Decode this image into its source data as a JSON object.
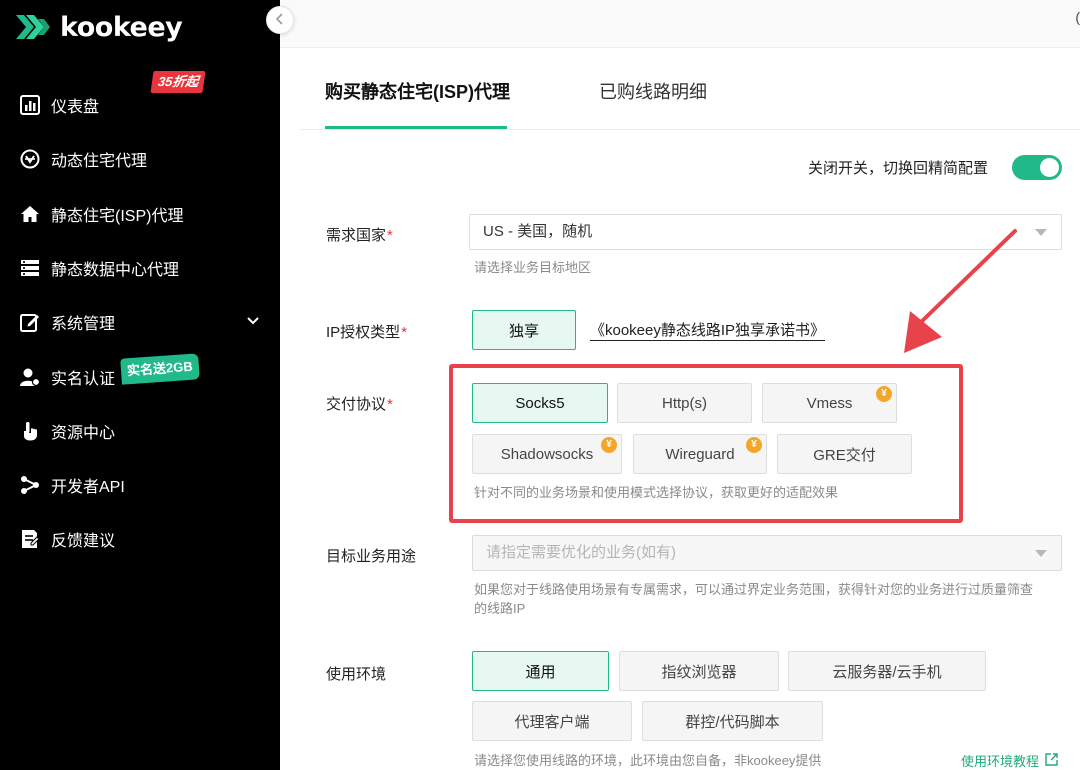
{
  "sidebar": {
    "logo_text": "kookeey",
    "items": [
      {
        "label": "仪表盘",
        "icon": "dashboard-chart-icon"
      },
      {
        "label": "动态住宅代理",
        "icon": "dynamic-proxy-icon"
      },
      {
        "label": "静态住宅(ISP)代理",
        "icon": "home-icon"
      },
      {
        "label": "静态数据中心代理",
        "icon": "server-icon"
      },
      {
        "label": "系统管理",
        "icon": "edit-icon"
      },
      {
        "label": "实名认证",
        "icon": "user-verify-icon"
      },
      {
        "label": "资源中心",
        "icon": "hand-pointer-icon"
      },
      {
        "label": "开发者API",
        "icon": "api-nodes-icon"
      },
      {
        "label": "反馈建议",
        "icon": "feedback-icon"
      }
    ],
    "promo_badge": "35折起",
    "verify_badge": "实名送2GB"
  },
  "topbar": {
    "edge_text": "("
  },
  "tabs": [
    {
      "label": "购买静态住宅(ISP)代理",
      "active": true
    },
    {
      "label": "已购线路明细",
      "active": false
    }
  ],
  "toggle": {
    "label": "关闭开关，切换回精简配置",
    "on": true
  },
  "form": {
    "country": {
      "label": "需求国家",
      "value": "US - 美国，随机",
      "hint": "请选择业务目标地区"
    },
    "ip_auth": {
      "label": "IP授权类型",
      "option": "独享",
      "agreement": "《kookeey静态线路IP独享承诺书》"
    },
    "protocol": {
      "label": "交付协议",
      "options": [
        {
          "label": "Socks5"
        },
        {
          "label": "Http(s)"
        },
        {
          "label": "Vmess"
        },
        {
          "label": "Shadowsocks"
        },
        {
          "label": "Wireguard"
        },
        {
          "label": "GRE交付"
        }
      ],
      "hint": "针对不同的业务场景和使用模式选择协议，获取更好的适配效果",
      "coin_symbol": "¥"
    },
    "business": {
      "label": "目标业务用途",
      "placeholder": "请指定需要优化的业务(如有)",
      "hint1": "如果您对于线路使用场景有专属需求，可以通过界定业务范围，获得针对您的业务进行过质量筛查",
      "hint2": "的线路IP"
    },
    "environment": {
      "label": "使用环境",
      "options": [
        {
          "label": "通用"
        },
        {
          "label": "指纹浏览器"
        },
        {
          "label": "云服务器/云手机"
        },
        {
          "label": "代理客户端"
        },
        {
          "label": "群控/代码脚本"
        }
      ],
      "hint": "请选择您使用线路的环境，此环境由您自备，非kookeey提供",
      "tutorial_link": "使用环境教程"
    }
  },
  "colors": {
    "accent": "#21b989",
    "highlight": "#e8424c",
    "sidebar_bg": "#000000",
    "promo_red": "#e8343c"
  }
}
